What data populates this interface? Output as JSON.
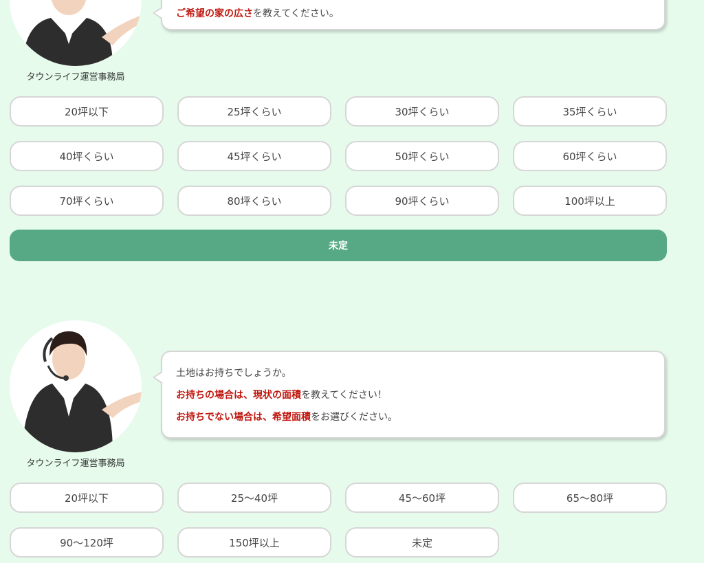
{
  "colors": {
    "background": "#e6fbec",
    "accent_green": "#56a984",
    "highlight_red": "#c0170e"
  },
  "section1": {
    "agent_name": "タウンライフ運営事務局",
    "message_highlight": "ご希望の家の広さ",
    "message_rest": "を教えてください。",
    "options": [
      "20坪以下",
      "25坪くらい",
      "30坪くらい",
      "35坪くらい",
      "40坪くらい",
      "45坪くらい",
      "50坪くらい",
      "60坪くらい",
      "70坪くらい",
      "80坪くらい",
      "90坪くらい",
      "100坪以上"
    ],
    "undecided_label": "未定"
  },
  "section2": {
    "agent_name": "タウンライフ運営事務局",
    "line1": "土地はお持ちでしょうか。",
    "line2_highlight": "お持ちの場合は、現状の面積",
    "line2_rest": "を教えてください！",
    "line3_highlight": "お持ちでない場合は、希望面積",
    "line3_rest": "をお選びください。",
    "options": [
      "20坪以下",
      "25〜40坪",
      "45〜60坪",
      "65〜80坪",
      "90〜120坪",
      "150坪以上",
      "未定"
    ]
  }
}
